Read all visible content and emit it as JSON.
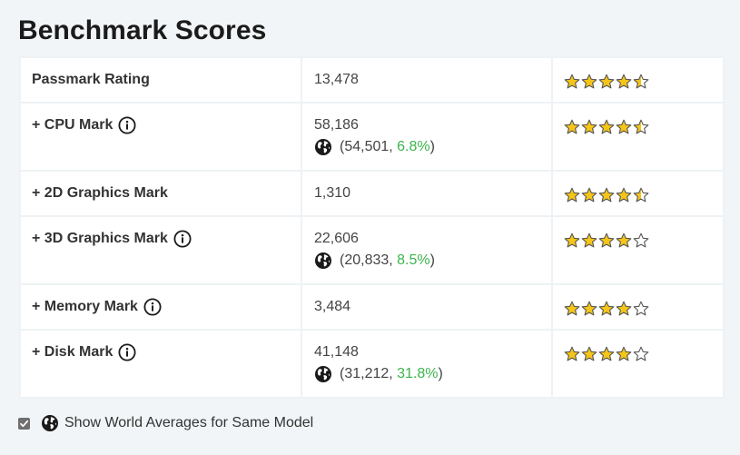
{
  "title": "Benchmark Scores",
  "rows": [
    {
      "label": "Passmark Rating",
      "value": "13,478",
      "world": null,
      "stars": [
        1,
        1,
        1,
        1,
        0.5
      ],
      "info": false
    },
    {
      "label": "+ CPU Mark",
      "value": "58,186",
      "world": {
        "avg": "54,501",
        "pct": "6.8%"
      },
      "stars": [
        1,
        1,
        1,
        1,
        0.5
      ],
      "info": true
    },
    {
      "label": "+ 2D Graphics Mark",
      "value": "1,310",
      "world": null,
      "stars": [
        1,
        1,
        1,
        1,
        0.5
      ],
      "info": false
    },
    {
      "label": "+ 3D Graphics Mark",
      "value": "22,606",
      "world": {
        "avg": "20,833",
        "pct": "8.5%"
      },
      "stars": [
        1,
        1,
        1,
        1,
        0
      ],
      "info": true
    },
    {
      "label": "+ Memory Mark",
      "value": "3,484",
      "world": null,
      "stars": [
        1,
        1,
        1,
        1,
        0
      ],
      "info": true
    },
    {
      "label": "+ Disk Mark",
      "value": "41,148",
      "world": {
        "avg": "31,212",
        "pct": "31.8%"
      },
      "stars": [
        1,
        1,
        1,
        1,
        0
      ],
      "info": true
    }
  ],
  "footer": {
    "checkbox_checked": true,
    "label": "Show World Averages for Same Model"
  },
  "colors": {
    "star_fill": "#f5c518",
    "star_outline": "#555555",
    "percent": "#3cb44b",
    "globe": "#1a1a1a"
  },
  "icons": {
    "info": "info-circle-icon",
    "globe": "globe-icon",
    "star": "star-icon"
  }
}
